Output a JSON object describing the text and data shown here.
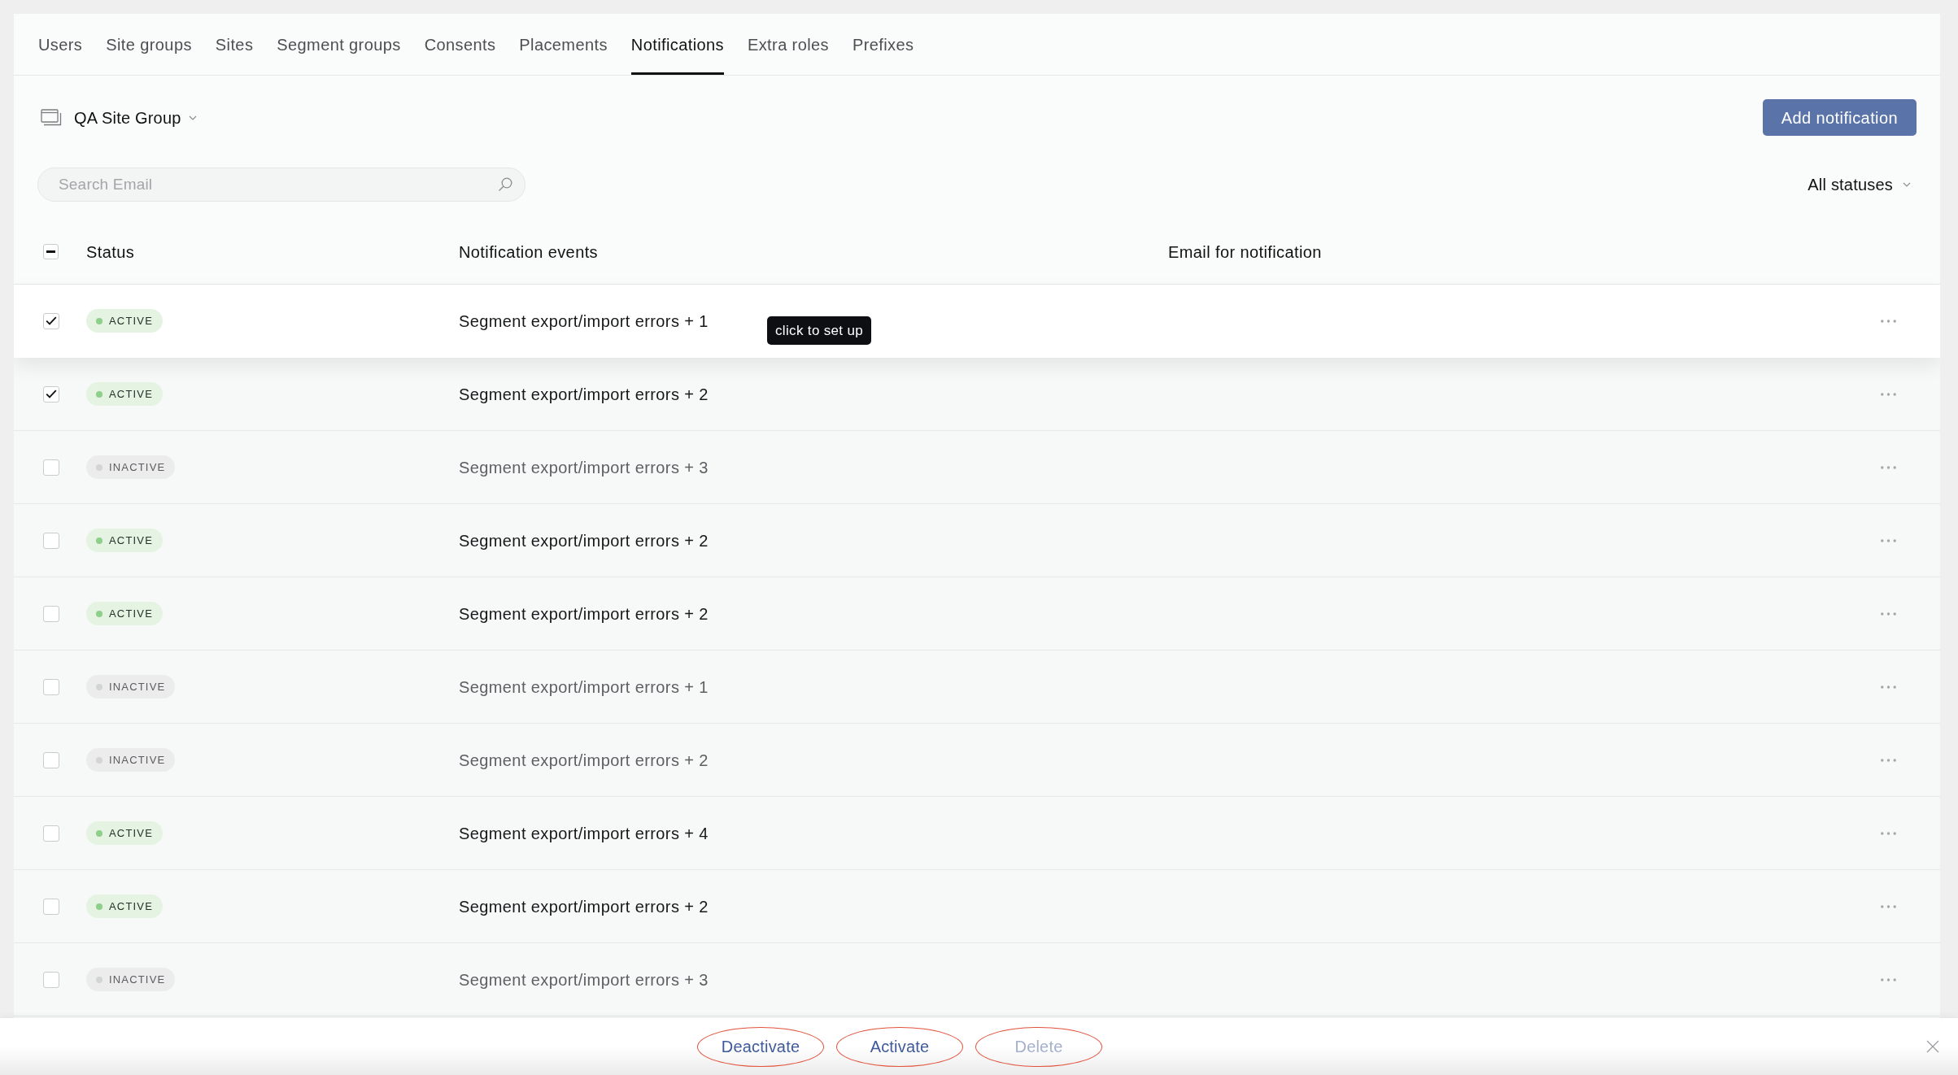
{
  "tabs": [
    {
      "label": "Users",
      "selected": false
    },
    {
      "label": "Site groups",
      "selected": false
    },
    {
      "label": "Sites",
      "selected": false
    },
    {
      "label": "Segment groups",
      "selected": false
    },
    {
      "label": "Consents",
      "selected": false
    },
    {
      "label": "Placements",
      "selected": false
    },
    {
      "label": "Notifications",
      "selected": true
    },
    {
      "label": "Extra roles",
      "selected": false
    },
    {
      "label": "Prefixes",
      "selected": false
    }
  ],
  "site_group": {
    "label": "QA Site Group"
  },
  "add_button": {
    "label": "Add notification"
  },
  "search": {
    "placeholder": "Search Email"
  },
  "status_filter": {
    "label": "All statuses"
  },
  "table": {
    "select_all": {
      "indeterminate": true
    },
    "columns": [
      "Status",
      "Notification events",
      "Email for notification"
    ],
    "rows": [
      {
        "checked": true,
        "status": "ACTIVE",
        "active": true,
        "events": "Segment export/import errors + 1",
        "hovered": true,
        "tooltip": "click to set up"
      },
      {
        "checked": true,
        "status": "ACTIVE",
        "active": true,
        "events": "Segment export/import errors + 2",
        "hovered": false
      },
      {
        "checked": false,
        "status": "INACTIVE",
        "active": false,
        "events": "Segment export/import errors + 3",
        "hovered": false
      },
      {
        "checked": false,
        "status": "ACTIVE",
        "active": true,
        "events": "Segment export/import errors + 2",
        "hovered": false
      },
      {
        "checked": false,
        "status": "ACTIVE",
        "active": true,
        "events": "Segment export/import errors + 2",
        "hovered": false
      },
      {
        "checked": false,
        "status": "INACTIVE",
        "active": false,
        "events": "Segment export/import errors + 1",
        "hovered": false
      },
      {
        "checked": false,
        "status": "INACTIVE",
        "active": false,
        "events": "Segment export/import errors + 2",
        "hovered": false
      },
      {
        "checked": false,
        "status": "ACTIVE",
        "active": true,
        "events": "Segment export/import errors + 4",
        "hovered": false
      },
      {
        "checked": false,
        "status": "ACTIVE",
        "active": true,
        "events": "Segment export/import errors + 2",
        "hovered": false
      },
      {
        "checked": false,
        "status": "INACTIVE",
        "active": false,
        "events": "Segment export/import errors + 3",
        "hovered": false
      }
    ]
  },
  "action_bar": {
    "buttons": [
      {
        "label": "Deactivate",
        "disabled": false
      },
      {
        "label": "Activate",
        "disabled": false
      },
      {
        "label": "Delete",
        "disabled": true
      }
    ]
  }
}
